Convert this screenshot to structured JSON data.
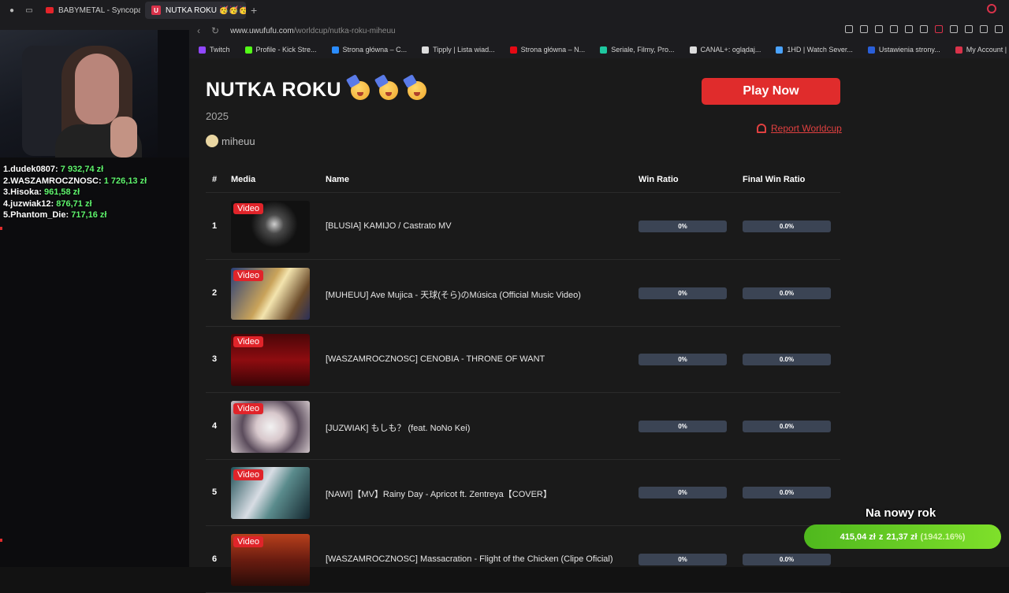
{
  "browser": {
    "tabs": [
      {
        "label": "BABYMETAL - Syncopatio",
        "active": false
      },
      {
        "label": "NUTKA ROKU 🥳🥳🥳 | U",
        "active": true
      }
    ],
    "url_domain": "www.uwufufu.com",
    "url_path": "/worldcup/nutka-roku-miheuu",
    "bookmarks": [
      {
        "label": "Twitch",
        "color": "#9147ff"
      },
      {
        "label": "Profile - Kick Stre...",
        "color": "#53fc18"
      },
      {
        "label": "Strona główna – C...",
        "color": "#2a8cff"
      },
      {
        "label": "Tipply | Lista wiad...",
        "color": "#dddddd"
      },
      {
        "label": "Strona główna – N...",
        "color": "#e50914"
      },
      {
        "label": "Seriale, Filmy, Pro...",
        "color": "#1ec8a0"
      },
      {
        "label": "CANAL+: oglądaj...",
        "color": "#dddddd"
      },
      {
        "label": "1HD | Watch Sever...",
        "color": "#4aa3ff"
      },
      {
        "label": "Ustawienia strony...",
        "color": "#2a5fd9"
      },
      {
        "label": "My Account | Infra...",
        "color": "#d9324a"
      }
    ]
  },
  "leaderboard": [
    {
      "rank_name": "1.dudek0807:",
      "amount": "7 932,74 zł"
    },
    {
      "rank_name": "2.WASZAMROCZNOSC:",
      "amount": "1 726,13 zł"
    },
    {
      "rank_name": "3.Hisoka:",
      "amount": "961,58 zł"
    },
    {
      "rank_name": "4.juzwiak12:",
      "amount": "876,71 zł"
    },
    {
      "rank_name": "5.Phantom_Die:",
      "amount": "717,16 zł"
    }
  ],
  "worldcup": {
    "title": "NUTKA ROKU",
    "year": "2025",
    "author": "miheuu",
    "play_label": "Play Now",
    "report_label": "Report Worldcup"
  },
  "table": {
    "headers": {
      "num": "#",
      "media": "Media",
      "name": "Name",
      "win": "Win Ratio",
      "final": "Final Win Ratio"
    },
    "badge": "Video",
    "rows": [
      {
        "num": "1",
        "name": "[BLUSIA] KAMIJO / Castrato MV",
        "win": "0%",
        "final": "0.0%"
      },
      {
        "num": "2",
        "name": "[MUHEUU] Ave Mujica - 天球(そら)のMúsica (Official Music Video)",
        "win": "0%",
        "final": "0.0%"
      },
      {
        "num": "3",
        "name": "[WASZAMROCZNOSC] CENOBIA - THRONE OF WANT",
        "win": "0%",
        "final": "0.0%"
      },
      {
        "num": "4",
        "name": "[JUZWIAK] もしも？ (feat. NoNo Kei)",
        "win": "0%",
        "final": "0.0%"
      },
      {
        "num": "5",
        "name": "[NAWI]【MV】Rainy Day - Apricot ft. Zentreya【COVER】",
        "win": "0%",
        "final": "0.0%"
      },
      {
        "num": "6",
        "name": "[WASZAMROCZNOSC] Massacration - Flight of the Chicken (Clipe Oficial)",
        "win": "0%",
        "final": "0.0%"
      }
    ]
  },
  "goal": {
    "label": "Na nowy rok",
    "current": "415,04 zł",
    "separator": "z",
    "target": "21,37 zł",
    "percent": "(1942.16%)",
    "progress_fraction": 1.0
  }
}
